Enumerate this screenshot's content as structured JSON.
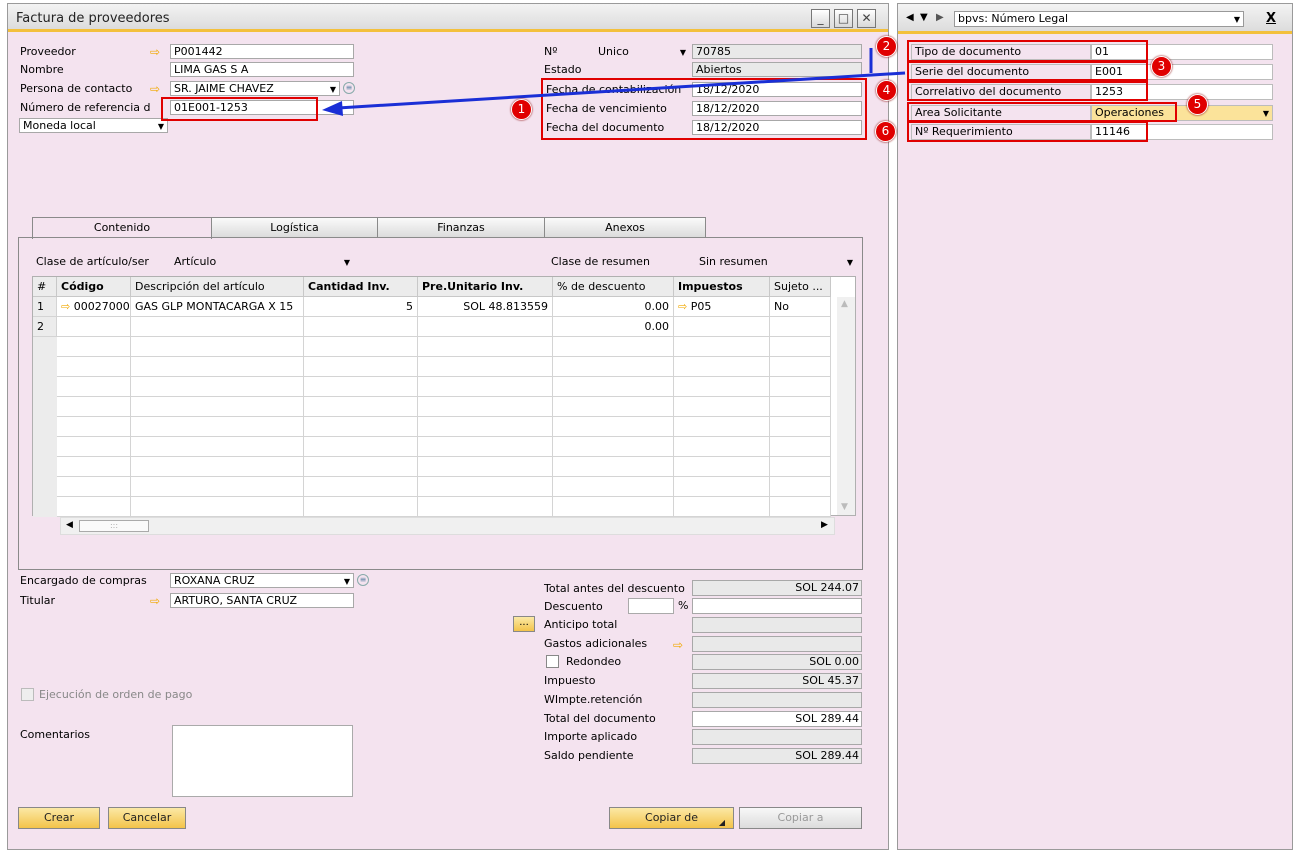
{
  "main_window": {
    "title": "Factura de proveedores",
    "fields": {
      "proveedor_label": "Proveedor",
      "proveedor_value": "P001442",
      "nombre_label": "Nombre",
      "nombre_value": "LIMA GAS S A",
      "contacto_label": "Persona de contacto",
      "contacto_value": "SR. JAIME CHAVEZ",
      "referencia_label": "Número de referencia d",
      "referencia_value": "01E001-1253",
      "moneda_value": "Moneda local",
      "no_label": "Nº",
      "no_series": "Unico",
      "no_value": "70785",
      "estado_label": "Estado",
      "estado_value": "Abiertos",
      "fecha_contab_label": "Fecha de contabilización",
      "fecha_contab_value": "18/12/2020",
      "fecha_venc_label": "Fecha de vencimiento",
      "fecha_venc_value": "18/12/2020",
      "fecha_doc_label": "Fecha del documento",
      "fecha_doc_value": "18/12/2020"
    },
    "tabs": [
      "Contenido",
      "Logística",
      "Finanzas",
      "Anexos"
    ],
    "content": {
      "clase_label": "Clase de artículo/ser",
      "clase_value": "Artículo",
      "resumen_label": "Clase de resumen",
      "resumen_value": "Sin resumen",
      "columns": [
        "#",
        "Código",
        "Descripción del artículo",
        "Cantidad Inv.",
        "Pre.Unitario Inv.",
        "% de descuento",
        "Impuestos",
        "Sujeto ..."
      ],
      "rows": [
        [
          "1",
          "00027000",
          "GAS GLP MONTACARGA X 15",
          "5",
          "SOL 48.813559",
          "0.00",
          "P05",
          "No"
        ],
        [
          "2",
          "",
          "",
          "",
          "",
          "0.00",
          "",
          ""
        ]
      ]
    },
    "footer": {
      "encargado_label": "Encargado de compras",
      "encargado_value": "ROXANA CRUZ",
      "titular_label": "Titular",
      "titular_value": "ARTURO, SANTA CRUZ",
      "ejecucion_label": "Ejecución de orden de pago",
      "comentarios_label": "Comentarios",
      "crear": "Crear",
      "cancelar": "Cancelar",
      "copiar_de": "Copiar de",
      "copiar_a": "Copiar a"
    },
    "totals": {
      "antes_label": "Total antes del descuento",
      "antes_value": "SOL 244.07",
      "descuento_label": "Descuento",
      "pct": "%",
      "anticipo_label": "Anticipo total",
      "anticipo_btn": "...",
      "gastos_label": "Gastos adicionales",
      "redondeo_label": "Redondeo",
      "redondeo_value": "SOL 0.00",
      "impuesto_label": "Impuesto",
      "impuesto_value": "SOL 45.37",
      "wimpte_label": "WImpte.retención",
      "total_label": "Total del documento",
      "total_value": "SOL 289.44",
      "aplicado_label": "Importe aplicado",
      "saldo_label": "Saldo pendiente",
      "saldo_value": "SOL 289.44"
    }
  },
  "right_panel": {
    "header": "bpvs: Número Legal",
    "close": "X",
    "fields": [
      {
        "label": "Tipo de documento",
        "value": "01"
      },
      {
        "label": "Serie del documento",
        "value": "E001"
      },
      {
        "label": "Correlativo del documento",
        "value": "1253"
      },
      {
        "label": "Area Solicitante",
        "value": "Operaciones"
      },
      {
        "label": "Nº Requerimiento",
        "value": "11146"
      }
    ]
  },
  "badges": [
    "1",
    "2",
    "3",
    "4",
    "5",
    "6"
  ],
  "colors": {
    "bg": "#f4e3ef",
    "accent": "#f3c03c",
    "annotation": "#e00000",
    "arrow": "#1a2fd6"
  }
}
